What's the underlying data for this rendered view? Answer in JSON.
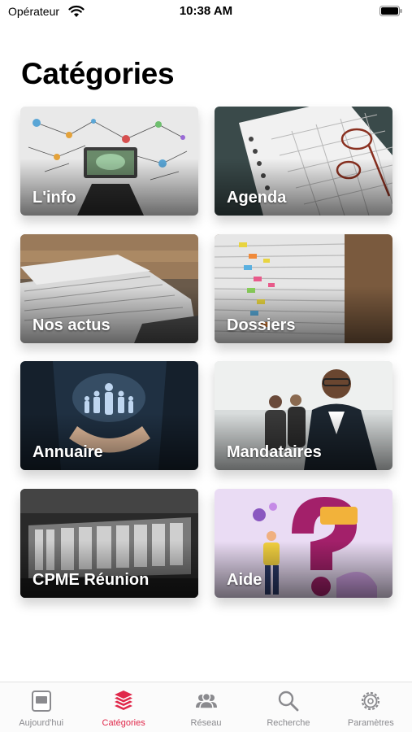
{
  "status_bar": {
    "carrier": "Opérateur",
    "time": "10:38 AM"
  },
  "page": {
    "title": "Catégories"
  },
  "categories": [
    {
      "label": "L'info"
    },
    {
      "label": "Agenda"
    },
    {
      "label": "Nos actus"
    },
    {
      "label": "Dossiers"
    },
    {
      "label": "Annuaire"
    },
    {
      "label": "Mandataires"
    },
    {
      "label": "CPME Réunion"
    },
    {
      "label": "Aide"
    }
  ],
  "tab_bar": {
    "accent": "#e0284a",
    "inactive": "#8a8a8e",
    "tabs": [
      {
        "label": "Aujourd'hui",
        "icon": "today-icon",
        "active": false
      },
      {
        "label": "Catégories",
        "icon": "layers-icon",
        "active": true
      },
      {
        "label": "Réseau",
        "icon": "people-icon",
        "active": false
      },
      {
        "label": "Recherche",
        "icon": "search-icon",
        "active": false
      },
      {
        "label": "Paramètres",
        "icon": "gear-icon",
        "active": false
      }
    ]
  }
}
